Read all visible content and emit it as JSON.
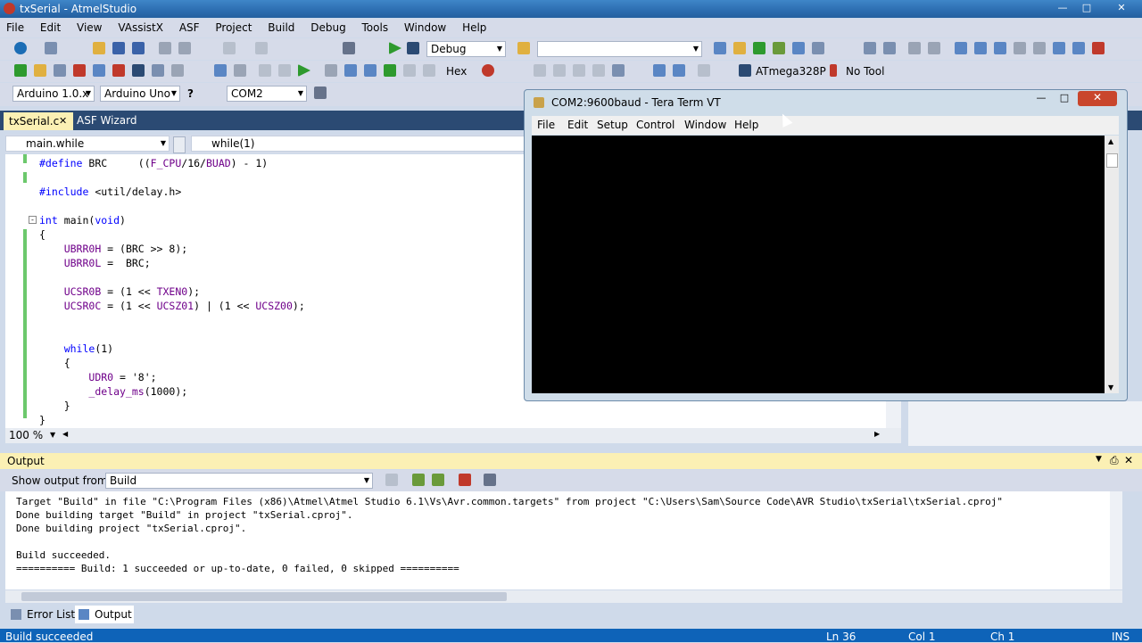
{
  "window": {
    "title": "txSerial - AtmelStudio"
  },
  "menu": [
    "File",
    "Edit",
    "View",
    "VAssistX",
    "ASF",
    "Project",
    "Build",
    "Debug",
    "Tools",
    "Window",
    "Help"
  ],
  "toolbar1": {
    "config_value": "Debug",
    "search_value": ""
  },
  "toolbar2": {
    "hex_label": "Hex",
    "device_label": "ATmega328P",
    "tool_label": "No Tool"
  },
  "toolbar3": {
    "arduino_version": "Arduino 1.0.x",
    "board": "Arduino Uno",
    "port": "COM2"
  },
  "tabs": {
    "active": "txSerial.c",
    "inactive": "ASF Wizard"
  },
  "navbar": {
    "scope": "main.while",
    "member": "while(1)"
  },
  "code": [
    {
      "text": "#define BRC     ((F_CPU/16/BUAD) - 1)"
    },
    {
      "text": ""
    },
    {
      "text": "#include <util/delay.h>"
    },
    {
      "text": ""
    },
    {
      "text": "int main(void)"
    },
    {
      "text": "{"
    },
    {
      "text": "    UBRR0H = (BRC >> 8);"
    },
    {
      "text": "    UBRR0L =  BRC;"
    },
    {
      "text": ""
    },
    {
      "text": "    UCSR0B = (1 << TXEN0);"
    },
    {
      "text": "    UCSR0C = (1 << UCSZ01) | (1 << UCSZ00);"
    },
    {
      "text": ""
    },
    {
      "text": ""
    },
    {
      "text": "    while(1)"
    },
    {
      "text": "    {"
    },
    {
      "text": "        UDR0 = '8';"
    },
    {
      "text": "        _delay_ms(1000);"
    },
    {
      "text": "    }"
    },
    {
      "text": "}"
    }
  ],
  "zoom": "100 %",
  "output": {
    "title": "Output",
    "show_from_label": "Show output from:",
    "source": "Build",
    "lines": [
      "Target \"Build\" in file \"C:\\Program Files (x86)\\Atmel\\Atmel Studio 6.1\\Vs\\Avr.common.targets\" from project \"C:\\Users\\Sam\\Source Code\\AVR Studio\\txSerial\\txSerial.cproj\"",
      "Done building target \"Build\" in project \"txSerial.cproj\".",
      "Done building project \"txSerial.cproj\".",
      "",
      "Build succeeded.",
      "========== Build: 1 succeeded or up-to-date, 0 failed, 0 skipped =========="
    ]
  },
  "bottom_tabs": [
    "Error List",
    "Output"
  ],
  "status": {
    "message": "Build succeeded",
    "ln": "Ln 36",
    "col": "Col 1",
    "ch": "Ch 1",
    "ins": "INS"
  },
  "teraterm": {
    "title": "COM2:9600baud - Tera Term VT",
    "menu": [
      "File",
      "Edit",
      "Setup",
      "Control",
      "Window",
      "Help"
    ]
  }
}
